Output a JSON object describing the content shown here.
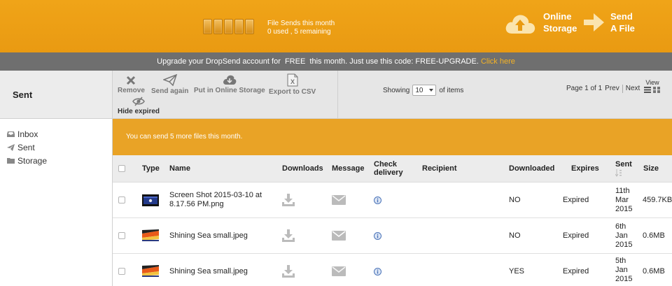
{
  "header": {
    "sends_title": "File Sends this month",
    "sends_status": "0 used , 5 remaining",
    "storage_line1": "Online",
    "storage_line2": "Storage",
    "sendfile_line1": "Send",
    "sendfile_line2": "A File"
  },
  "promo": {
    "text": "Upgrade your DropSend account for  FREE  this month. Just use this code: FREE-UPGRADE.",
    "link": "Click here"
  },
  "sidebar": {
    "title": "Sent",
    "items": [
      {
        "label": "Inbox",
        "icon": "inbox-icon"
      },
      {
        "label": "Sent",
        "icon": "paper-plane-icon"
      },
      {
        "label": "Storage",
        "icon": "folder-icon"
      }
    ]
  },
  "toolbar": {
    "remove": "Remove",
    "send_again": "Send again",
    "put_storage": "Put in Online Storage",
    "export_csv": "Export to CSV",
    "hide_expired": "Hide expired",
    "showing_label": "Showing",
    "showing_value": "10",
    "showing_suffix": "of items",
    "page_info": "Page 1 of 1",
    "prev": "Prev",
    "next": "Next",
    "view": "View"
  },
  "notice": "You can send 5 more files this month.",
  "table": {
    "headers": {
      "type": "Type",
      "name": "Name",
      "downloads": "Downloads",
      "message": "Message",
      "check1": "Check",
      "check2": "delivery",
      "recipient": "Recipient",
      "downloaded": "Downloaded",
      "expires": "Expires",
      "sent": "Sent",
      "size": "Size"
    },
    "rows": [
      {
        "name1": "Screen Shot 2015-03-10 at",
        "name2": "8.17.56 PM.png",
        "downloaded": "NO",
        "expires": "Expired",
        "sent1": "11th",
        "sent2": "Mar",
        "sent3": "2015",
        "size": "459.7KB"
      },
      {
        "name1": "Shining Sea small.jpeg",
        "name2": "",
        "downloaded": "NO",
        "expires": "Expired",
        "sent1": "6th",
        "sent2": "Jan",
        "sent3": "2015",
        "size": "0.6MB"
      },
      {
        "name1": "Shining Sea small.jpeg",
        "name2": "",
        "downloaded": "YES",
        "expires": "Expired",
        "sent1": "5th",
        "sent2": "Jan",
        "sent3": "2015",
        "size": "0.6MB"
      }
    ]
  },
  "colors": {
    "header_orange": "#f0a418",
    "promo_gray": "#6f6f6f",
    "notice_orange": "#e9a326",
    "link_orange": "#f5b325"
  }
}
